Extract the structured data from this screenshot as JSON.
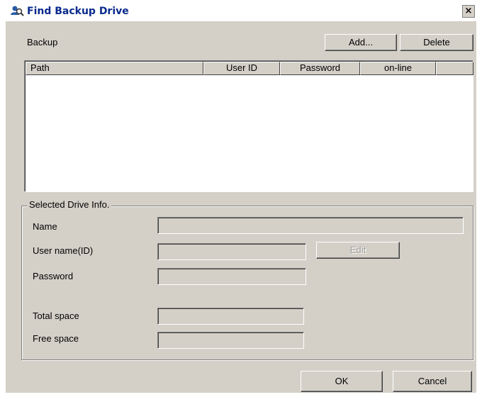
{
  "window": {
    "title": "Find Backup Drive",
    "close_glyph": "×"
  },
  "backup": {
    "label": "Backup",
    "add_label": "Add...",
    "delete_label": "Delete",
    "columns": [
      "Path",
      "User ID",
      "Password",
      "on-line",
      ""
    ]
  },
  "drive_info": {
    "group_label": "Selected Drive Info.",
    "name_label": "Name",
    "username_label": "User name(ID)",
    "password_label": "Password",
    "total_label": "Total space",
    "free_label": "Free space",
    "edit_label": "Edit",
    "name_value": "",
    "username_value": "",
    "password_value": "",
    "total_value": "",
    "free_value": ""
  },
  "footer": {
    "ok_label": "OK",
    "cancel_label": "Cancel"
  },
  "icons": {
    "title_icon": "user-search-icon",
    "close_icon": "close-icon"
  }
}
